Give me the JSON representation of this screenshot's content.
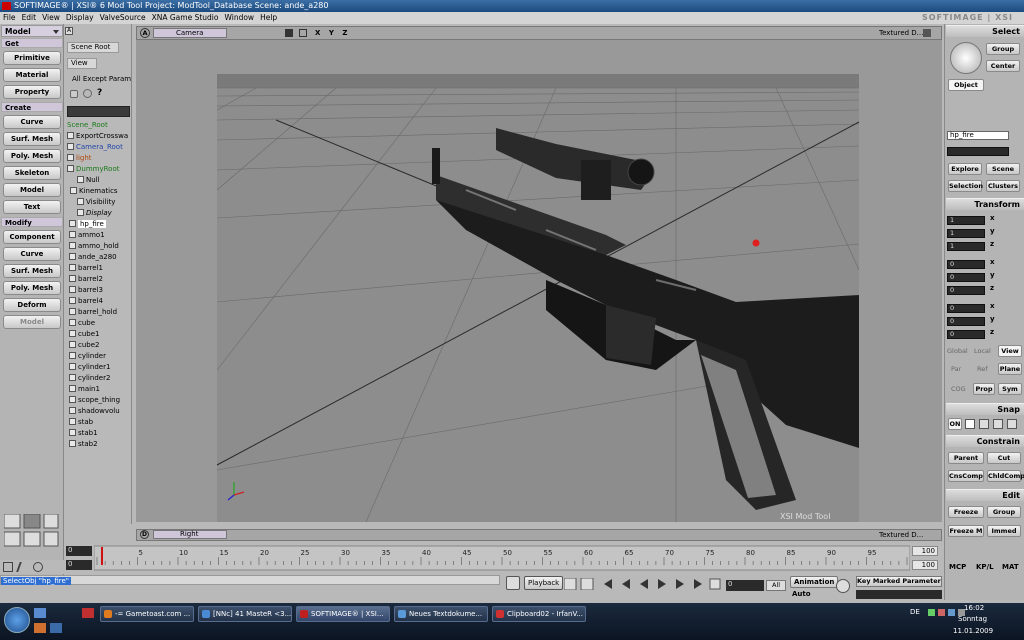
{
  "window": {
    "title": "SOFTIMAGE® | XSI® 6 Mod Tool Project: ModTool_Database    Scene: ande_a280"
  },
  "menu": {
    "items": [
      "File",
      "Edit",
      "View",
      "Display",
      "ValveSource",
      "XNA Game Studio",
      "Window",
      "Help"
    ],
    "brand": "SOFTIMAGE | XSI"
  },
  "left_toolbar": {
    "mode": "Model",
    "get_label": "Get",
    "get_buttons": [
      "Primitive",
      "Material",
      "Property"
    ],
    "create_label": "Create",
    "create_buttons": [
      "Curve",
      "Surf. Mesh",
      "Poly. Mesh",
      "Skeleton",
      "Model",
      "Text"
    ],
    "modify_label": "Modify",
    "modify_buttons": [
      "Component",
      "Curve",
      "Surf. Mesh",
      "Poly. Mesh",
      "Deform",
      "Model"
    ]
  },
  "explorer": {
    "scope_button": "Scene Root",
    "view_button": "View",
    "filter_label": "All Except Params",
    "items": [
      "Scene_Root",
      "ExportCrosswa",
      "Camera_Root",
      "light",
      "DummyRoot",
      "Null",
      "Kinematics",
      "Visibility",
      "Display",
      "hp_fire",
      "ammo1",
      "ammo_hold",
      "ande_a280",
      "barrel1",
      "barrel2",
      "barrel3",
      "barrel4",
      "barrel_hold",
      "cube",
      "cube1",
      "cube2",
      "cylinder",
      "cylinder1",
      "cylinder2",
      "main1",
      "scope_thing",
      "shadowvolu",
      "stab",
      "stab1",
      "stab2"
    ],
    "selected": "hp_fire"
  },
  "viewport_a": {
    "letter": "A",
    "camera": "Camera",
    "axes": "X Y Z",
    "mode": "Textured D...",
    "watermark": "XSI  Mod  Tool"
  },
  "viewport_d": {
    "letter": "D",
    "camera": "Right",
    "mode": "Textured D..."
  },
  "right_panel": {
    "select_label": "Select",
    "group_btn": "Group",
    "center_btn": "Center",
    "object_btn": "Object",
    "name_field": "hp_fire",
    "explore_btn": "Explore",
    "scene_btn": "Scene",
    "selection_btn": "Selection",
    "clusters_btn": "Clusters",
    "transform_label": "Transform",
    "scale": [
      "1",
      "1",
      "1"
    ],
    "rotate": [
      "0",
      "0",
      "0"
    ],
    "translate": [
      "0",
      "0",
      "0"
    ],
    "axis_labels": [
      "x",
      "y",
      "z"
    ],
    "ref_modes": [
      "Global",
      "Local",
      "View"
    ],
    "par_ref_plane": [
      "Par",
      "Ref",
      "Plane"
    ],
    "cog_prop_sym": [
      "COG",
      "Prop",
      "Sym"
    ],
    "snap_label": "Snap",
    "snap_on": "ON",
    "constrain_label": "Constrain",
    "constrain_buttons": [
      "Parent",
      "Cut",
      "CnsComp",
      "ChldComp"
    ],
    "edit_label": "Edit",
    "edit_buttons": [
      "Freeze",
      "Group",
      "Freeze M",
      "Immed"
    ],
    "bottom_tabs": [
      "MCP",
      "KP/L",
      "MAT"
    ]
  },
  "timeline": {
    "start": "0",
    "end": "100",
    "current": "0",
    "ticks": [
      "5",
      "10",
      "15",
      "20",
      "25",
      "30",
      "35",
      "40",
      "45",
      "50",
      "55",
      "60",
      "65",
      "70",
      "75",
      "80",
      "85",
      "90",
      "95"
    ],
    "end2": "100",
    "start2": "0",
    "current2": "100"
  },
  "status": {
    "command": "SelectObj \"hp_fire\""
  },
  "playback": {
    "label": "Playback",
    "frame": "0",
    "all": "All",
    "animation": "Animation",
    "auto": "Auto",
    "key_btn": "Key Marked Parameters"
  },
  "taskbar": {
    "tasks": [
      {
        "label": "-= Gametoast.com ...",
        "color": "#e07b20"
      },
      {
        "label": "[NNc] 41 MasteR <3...",
        "color": "#4a8ad4"
      },
      {
        "label": "SOFTIMAGE® | XSI...",
        "color": "#c02020"
      },
      {
        "label": "Neues Textdokume...",
        "color": "#5a9ad8"
      },
      {
        "label": "Clipboard02 - IrfanV...",
        "color": "#d03030"
      }
    ],
    "lang": "DE",
    "time": "16:02",
    "day": "Sonntag",
    "date": "11.01.2009"
  }
}
